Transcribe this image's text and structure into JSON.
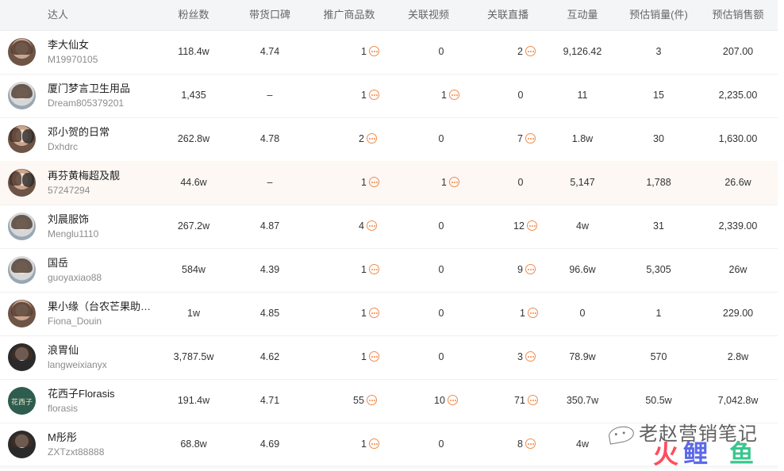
{
  "columns": {
    "influencer": "达人",
    "fans": "粉丝数",
    "reputation": "带货口碑",
    "products": "推广商品数",
    "videos": "关联视频",
    "lives": "关联直播",
    "interaction": "互动量",
    "sales_volume": "预估销量(件)",
    "sales_amount": "预估销售额"
  },
  "rows": [
    {
      "name": "李大仙女",
      "id": "M19970105",
      "fans": "118.4w",
      "reputation": "4.74",
      "products": "1",
      "videos": "0",
      "lives": "2",
      "interaction": "9,126.42",
      "sales_volume": "3",
      "sales_amount": "207.00"
    },
    {
      "name": "厦门梦言卫生用品",
      "id": "Dream805379201",
      "fans": "1,435",
      "reputation": "–",
      "products": "1",
      "videos": "1",
      "lives": "0",
      "interaction": "11",
      "sales_volume": "15",
      "sales_amount": "2,235.00"
    },
    {
      "name": "邓小贺的日常",
      "id": "Dxhdrc",
      "fans": "262.8w",
      "reputation": "4.78",
      "products": "2",
      "videos": "0",
      "lives": "7",
      "interaction": "1.8w",
      "sales_volume": "30",
      "sales_amount": "1,630.00"
    },
    {
      "name": "再芬黄梅超及靓",
      "id": "57247294",
      "fans": "44.6w",
      "reputation": "–",
      "products": "1",
      "videos": "1",
      "lives": "0",
      "interaction": "5,147",
      "sales_volume": "1,788",
      "sales_amount": "26.6w"
    },
    {
      "name": "刘晨服饰",
      "id": "Menglu1110",
      "fans": "267.2w",
      "reputation": "4.87",
      "products": "4",
      "videos": "0",
      "lives": "12",
      "interaction": "4w",
      "sales_volume": "31",
      "sales_amount": "2,339.00"
    },
    {
      "name": "国岳",
      "id": "guoyaxiao88",
      "fans": "584w",
      "reputation": "4.39",
      "products": "1",
      "videos": "0",
      "lives": "9",
      "interaction": "96.6w",
      "sales_volume": "5,305",
      "sales_amount": "26w"
    },
    {
      "name": "果小缘（台农芒果助农…",
      "id": "Fiona_Douin",
      "fans": "1w",
      "reputation": "4.85",
      "products": "1",
      "videos": "0",
      "lives": "1",
      "interaction": "0",
      "sales_volume": "1",
      "sales_amount": "229.00"
    },
    {
      "name": "浪胃仙",
      "id": "langweixianyx",
      "fans": "3,787.5w",
      "reputation": "4.62",
      "products": "1",
      "videos": "0",
      "lives": "3",
      "interaction": "78.9w",
      "sales_volume": "570",
      "sales_amount": "2.8w"
    },
    {
      "name": "花西子Florasis",
      "id": "florasis",
      "fans": "191.4w",
      "reputation": "4.71",
      "products": "55",
      "videos": "10",
      "lives": "71",
      "interaction": "350.7w",
      "sales_volume": "50.5w",
      "sales_amount": "7,042.8w"
    },
    {
      "name": "M彤彤",
      "id": "ZXTzxt88888",
      "fans": "68.8w",
      "reputation": "4.69",
      "products": "1",
      "videos": "0",
      "lives": "8",
      "interaction": "4w",
      "sales_volume": "",
      "sales_amount": ""
    }
  ],
  "avatar_logo_text": "花西子",
  "watermark": {
    "text": "老赵营销笔记",
    "logo": [
      "火",
      "鲤",
      "鱼"
    ],
    "icon": "wechat-icon"
  },
  "colors": {
    "accent": "#f08a4b",
    "header_bg": "#f4f5f7",
    "highlight_row": "#fdf8f4"
  },
  "icons": {
    "more": "more-dots-circle-icon"
  }
}
